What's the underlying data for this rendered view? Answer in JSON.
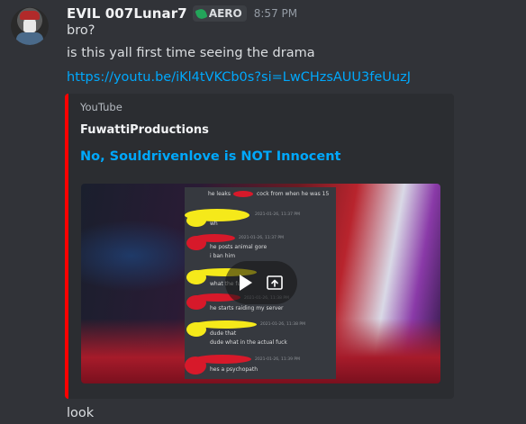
{
  "message": {
    "username": "EVIL 007Lunar7",
    "tag": "AERO",
    "timestamp": "8:57 PM",
    "lines": [
      "bro?",
      "is this yall first time seeing the drama"
    ],
    "link": "https://youtu.be/iKl4tVKCb0s?si=LwCHzsAUU3feUuzJ",
    "after": "look"
  },
  "embed": {
    "provider": "YouTube",
    "author": "FuwattiProductions",
    "title": "No, Souldrivenlove is NOT Innocent",
    "accent_color": "#ff0000",
    "thumbnail_chat": [
      "he leaks",
      "cock from when he was 15",
      "2021-01-26, 11:37 PM",
      "wh",
      "2021-01-26, 11:37 PM",
      "he posts animal gore",
      "i ban him",
      "what the fu",
      "2021-01-26, 11:38 PM",
      "he starts raiding my server",
      "2021-01-26, 11:38 PM",
      "dude that",
      "dude what in the actual fuck",
      "2021-01-26, 11:39 PM",
      "hes a psychopath"
    ]
  },
  "colors": {
    "link": "#00a8fc",
    "tag_icon": "#23a55a",
    "background": "#313338"
  }
}
